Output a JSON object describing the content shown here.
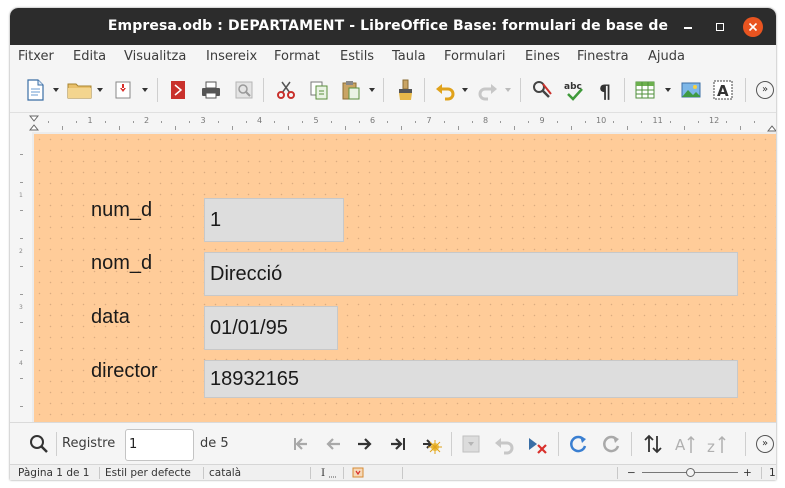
{
  "window": {
    "title": "Empresa.odb : DEPARTAMENT - LibreOffice Base: formulari de base de dades"
  },
  "menubar": {
    "items": [
      "Fitxer",
      "Edita",
      "Visualitza",
      "Insereix",
      "Format",
      "Estils",
      "Taula",
      "Formulari",
      "Eines",
      "Finestra",
      "Ajuda"
    ]
  },
  "toolbar": {
    "icons": [
      "new-document-icon",
      "open-folder-icon",
      "save-icon",
      "export-pdf-icon",
      "print-icon",
      "print-preview-icon",
      "cut-icon",
      "copy-icon",
      "paste-icon",
      "clone-formatting-icon",
      "undo-icon",
      "redo-icon",
      "find-replace-icon",
      "spellcheck-icon",
      "formatting-marks-icon",
      "insert-table-icon",
      "insert-image-icon",
      "insert-text-box-icon",
      "more-options-icon"
    ],
    "more_glyph": "»"
  },
  "ruler": {
    "numbers": [
      "1",
      "2",
      "3",
      "4",
      "5",
      "6",
      "7",
      "8",
      "9",
      "10",
      "11",
      "12"
    ],
    "vertical_numbers": [
      "1",
      "2",
      "3",
      "4"
    ]
  },
  "form": {
    "background": "#ffcc99",
    "fields": [
      {
        "label": "num_d",
        "value": "1"
      },
      {
        "label": "nom_d",
        "value": "Direcció"
      },
      {
        "label": "data",
        "value": "01/01/95"
      },
      {
        "label": "director",
        "value": "18932165"
      }
    ]
  },
  "navbar": {
    "record_label": "Registre",
    "record_value": "1",
    "of_label": "de 5",
    "more_glyph": "»"
  },
  "statusbar": {
    "page": "Pàgina 1 de 1",
    "style": "Estil per defecte",
    "language": "català",
    "insert_mode": "I",
    "zoom_minus": "−",
    "zoom_plus": "+",
    "zoom_value": "1"
  },
  "colors": {
    "titlebar": "#2c2c2c",
    "close_button": "#e95420",
    "form_background": "#ffcc99",
    "field_background": "#dddddd"
  }
}
